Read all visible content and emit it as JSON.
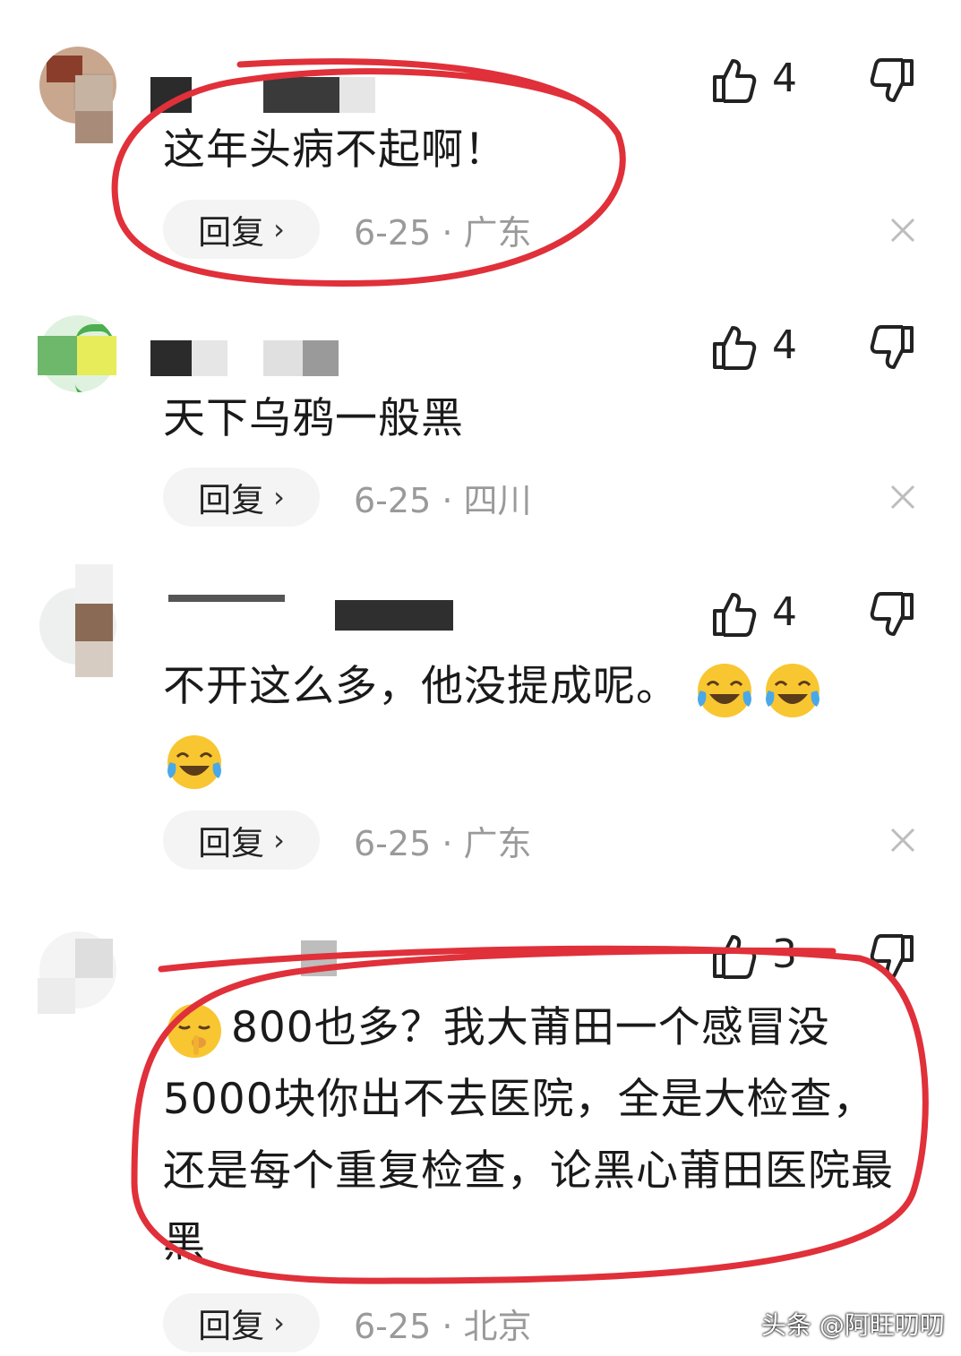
{
  "comments": [
    {
      "text": "这年头病不起啊！",
      "likes": "4",
      "reply": "回复",
      "date": "6-25 · 广东"
    },
    {
      "text": "天下乌鸦一般黑",
      "likes": "4",
      "reply": "回复",
      "date": "6-25 · 四川"
    },
    {
      "text": "不开这么多，他没提成呢。",
      "likes": "4",
      "reply": "回复",
      "date": "6-25 · 广东"
    },
    {
      "text": "800也多？我大莆田一个感冒没5000块你出不去医院，全是大检查，还是每个重复检查，论黑心莆田医院最黑",
      "likes": "3",
      "reply": "回复",
      "date": "6-25 · 北京"
    }
  ],
  "watermark": "头条 @阿旺叨叨",
  "icons": {
    "like": "thumbs-up-icon",
    "dislike": "thumbs-down-icon",
    "close": "close-icon",
    "reply_arrow": "chevron-right-icon",
    "crying_laughing": "laughing-crying-emoji",
    "shushing": "shushing-face-emoji"
  },
  "colors": {
    "annotation": "#e0303a",
    "meta_text": "#9a9a9a",
    "pill_bg": "#f4f4f4"
  }
}
